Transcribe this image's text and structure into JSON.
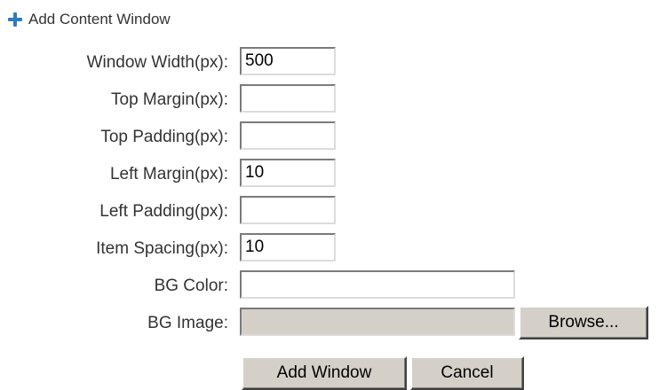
{
  "header": {
    "icon": "plus-icon",
    "label": "Add Content Window",
    "accent_color": "#2e7cc0"
  },
  "form": {
    "fields": [
      {
        "label": "Window Width(px):",
        "value": "500"
      },
      {
        "label": "Top Margin(px):",
        "value": ""
      },
      {
        "label": "Top Padding(px):",
        "value": ""
      },
      {
        "label": "Left Margin(px):",
        "value": "10"
      },
      {
        "label": "Left Padding(px):",
        "value": ""
      },
      {
        "label": "Item Spacing(px):",
        "value": "10"
      }
    ],
    "bg_color": {
      "label": "BG Color:",
      "value": ""
    },
    "bg_image": {
      "label": "BG Image:",
      "value": ""
    },
    "browse_label": "Browse...",
    "add_window_label": "Add Window",
    "cancel_label": "Cancel"
  }
}
